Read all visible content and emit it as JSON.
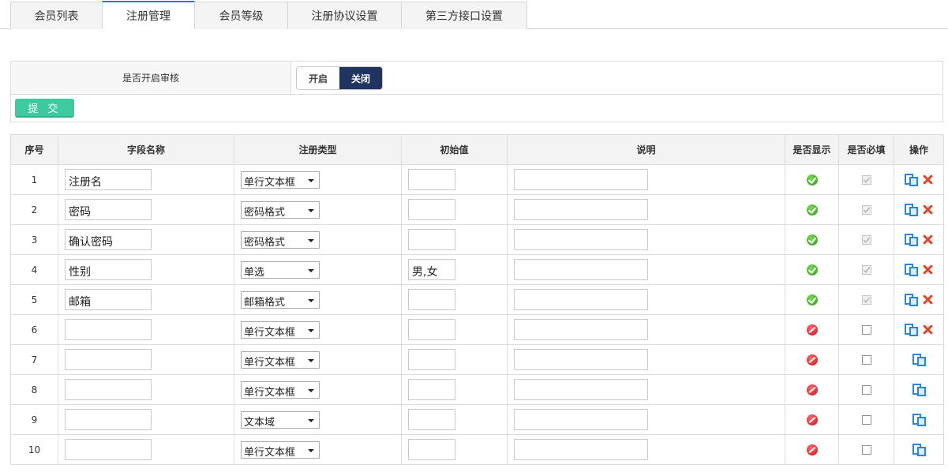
{
  "tabs": [
    {
      "label": "会员列表",
      "active": false
    },
    {
      "label": "注册管理",
      "active": true
    },
    {
      "label": "会员等级",
      "active": false
    },
    {
      "label": "注册协议设置",
      "active": false
    },
    {
      "label": "第三方接口设置",
      "active": false
    }
  ],
  "settings": {
    "audit_label": "是否开启审核",
    "toggle_on_label": "开启",
    "toggle_off_label": "关闭",
    "toggle_selected": "关闭",
    "submit_label": "提 交"
  },
  "table": {
    "headers": [
      "序号",
      "字段名称",
      "注册类型",
      "初始值",
      "说明",
      "是否显示",
      "是否必填",
      "操作"
    ],
    "rows": [
      {
        "index": "1",
        "name": "注册名",
        "type": "单行文本框",
        "initial": "",
        "desc": "",
        "visible": true,
        "required": true,
        "deletable": true
      },
      {
        "index": "2",
        "name": "密码",
        "type": "密码格式",
        "initial": "",
        "desc": "",
        "visible": true,
        "required": true,
        "deletable": true
      },
      {
        "index": "3",
        "name": "确认密码",
        "type": "密码格式",
        "initial": "",
        "desc": "",
        "visible": true,
        "required": true,
        "deletable": true
      },
      {
        "index": "4",
        "name": "性别",
        "type": "单选",
        "initial": "男,女",
        "desc": "",
        "visible": true,
        "required": true,
        "deletable": true
      },
      {
        "index": "5",
        "name": "邮箱",
        "type": "邮箱格式",
        "initial": "",
        "desc": "",
        "visible": true,
        "required": true,
        "deletable": true
      },
      {
        "index": "6",
        "name": "",
        "type": "单行文本框",
        "initial": "",
        "desc": "",
        "visible": false,
        "required": false,
        "deletable": true
      },
      {
        "index": "7",
        "name": "",
        "type": "单行文本框",
        "initial": "",
        "desc": "",
        "visible": false,
        "required": false,
        "deletable": false
      },
      {
        "index": "8",
        "name": "",
        "type": "单行文本框",
        "initial": "",
        "desc": "",
        "visible": false,
        "required": false,
        "deletable": false
      },
      {
        "index": "9",
        "name": "",
        "type": "文本域",
        "initial": "",
        "desc": "",
        "visible": false,
        "required": false,
        "deletable": false
      },
      {
        "index": "10",
        "name": "",
        "type": "单行文本框",
        "initial": "",
        "desc": "",
        "visible": false,
        "required": false,
        "deletable": false
      }
    ]
  },
  "icons": {
    "visible_yes": "check-circle-icon",
    "visible_no": "no-entry-icon",
    "edit": "edit-copy-icon",
    "delete": "delete-x-icon"
  }
}
